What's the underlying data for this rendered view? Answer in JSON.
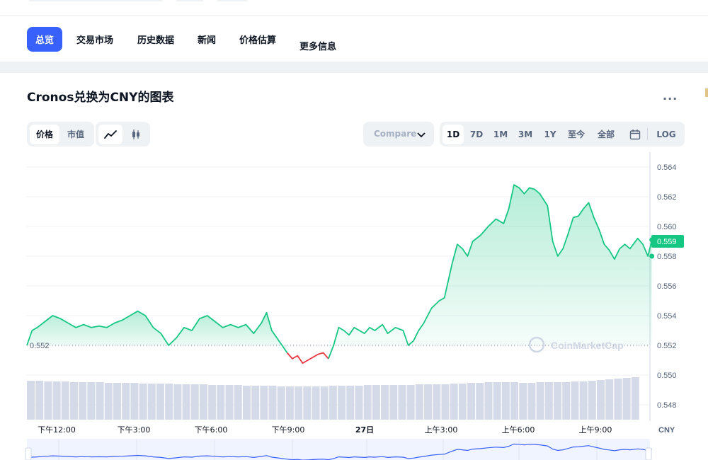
{
  "nav": {
    "tabs": [
      {
        "label": "总览",
        "active": true
      },
      {
        "label": "交易市场"
      },
      {
        "label": "历史数据"
      },
      {
        "label": "新闻"
      },
      {
        "label": "价格估算"
      },
      {
        "label": "更多信息"
      }
    ]
  },
  "chart_header": {
    "title": "Cronos兑换为CNY的图表",
    "more_label": "..."
  },
  "controls": {
    "metric_tabs": [
      "价格",
      "市值"
    ],
    "active_metric": "价格",
    "chart_types": [
      "line-chart-icon",
      "candlestick-icon"
    ],
    "compare_label": "Compare",
    "ranges": [
      "1D",
      "7D",
      "1M",
      "3M",
      "1Y",
      "至今",
      "全部"
    ],
    "active_range": "1D",
    "calendar_icon": "calendar-icon",
    "log_label": "LOG"
  },
  "colors": {
    "accent": "#3861fb",
    "up": "#16c784",
    "down": "#ea3943",
    "grid": "#eff2f5",
    "text_muted": "#58667e"
  },
  "chart_data": {
    "type": "line",
    "currency": "CNY",
    "ylim": [
      0.547,
      0.565
    ],
    "y_ticks": [
      "0.564",
      "0.562",
      "0.560",
      "0.558",
      "0.556",
      "0.554",
      "0.552",
      "0.550",
      "0.548"
    ],
    "x_tick_labels": [
      "下午12:00",
      "下午3:00",
      "下午6:00",
      "下午9:00",
      "27日",
      "上午3:00",
      "上午6:00",
      "上午9:00"
    ],
    "x_axis_unit_label": "CNY",
    "x_range_hours": [
      11.6,
      34.8
    ],
    "open_price": 0.552,
    "open_price_label": "0.552",
    "current_price": 0.559,
    "current_price_label": "0.559",
    "watermark": "CoinMarketCap",
    "series": [
      {
        "points": [
          [
            11.6,
            0.552
          ],
          [
            11.8,
            0.553
          ],
          [
            12.0,
            0.5532
          ],
          [
            12.3,
            0.5536
          ],
          [
            12.6,
            0.554
          ],
          [
            12.9,
            0.5538
          ],
          [
            13.2,
            0.5535
          ],
          [
            13.5,
            0.5532
          ],
          [
            13.8,
            0.5534
          ],
          [
            14.1,
            0.5532
          ],
          [
            14.4,
            0.5533
          ],
          [
            14.7,
            0.5532
          ],
          [
            15.0,
            0.5535
          ],
          [
            15.3,
            0.5537
          ],
          [
            15.6,
            0.554
          ],
          [
            15.9,
            0.5543
          ],
          [
            16.2,
            0.554
          ],
          [
            16.5,
            0.5532
          ],
          [
            16.8,
            0.5528
          ],
          [
            17.1,
            0.552
          ],
          [
            17.4,
            0.5525
          ],
          [
            17.7,
            0.5532
          ],
          [
            18.0,
            0.553
          ],
          [
            18.3,
            0.5538
          ],
          [
            18.6,
            0.554
          ],
          [
            18.9,
            0.5536
          ],
          [
            19.2,
            0.5532
          ],
          [
            19.5,
            0.5534
          ],
          [
            19.8,
            0.5532
          ],
          [
            20.1,
            0.5534
          ],
          [
            20.4,
            0.5528
          ],
          [
            20.7,
            0.5535
          ],
          [
            20.9,
            0.5542
          ],
          [
            21.1,
            0.553
          ],
          [
            21.3,
            0.5525
          ],
          [
            21.5,
            0.552
          ],
          [
            21.7,
            0.5515
          ]
        ]
      },
      {
        "points": [
          [
            21.7,
            0.5515
          ],
          [
            21.9,
            0.5511
          ],
          [
            22.1,
            0.5513
          ],
          [
            22.3,
            0.5508
          ],
          [
            22.5,
            0.551
          ],
          [
            22.7,
            0.5512
          ],
          [
            22.9,
            0.5514
          ],
          [
            23.1,
            0.5515
          ],
          [
            23.3,
            0.5511
          ]
        ]
      },
      {
        "points": [
          [
            23.3,
            0.5511
          ],
          [
            23.5,
            0.552
          ],
          [
            23.7,
            0.5532
          ],
          [
            23.9,
            0.553
          ],
          [
            24.1,
            0.5527
          ],
          [
            24.3,
            0.5532
          ],
          [
            24.5,
            0.553
          ],
          [
            24.7,
            0.5528
          ],
          [
            24.9,
            0.5532
          ],
          [
            25.1,
            0.553
          ],
          [
            25.4,
            0.5534
          ],
          [
            25.6,
            0.5528
          ],
          [
            25.9,
            0.5532
          ],
          [
            26.2,
            0.553
          ],
          [
            26.4,
            0.552
          ],
          [
            26.6,
            0.5523
          ],
          [
            26.8,
            0.553
          ],
          [
            27.0,
            0.5535
          ],
          [
            27.3,
            0.5545
          ],
          [
            27.6,
            0.555
          ],
          [
            27.8,
            0.5552
          ],
          [
            28.1,
            0.5575
          ],
          [
            28.3,
            0.5588
          ],
          [
            28.5,
            0.5585
          ],
          [
            28.7,
            0.558
          ],
          [
            28.9,
            0.559
          ],
          [
            29.2,
            0.5594
          ],
          [
            29.5,
            0.56
          ],
          [
            29.8,
            0.5605
          ],
          [
            30.1,
            0.5602
          ],
          [
            30.3,
            0.5612
          ],
          [
            30.5,
            0.5628
          ],
          [
            30.7,
            0.5626
          ],
          [
            30.9,
            0.5622
          ],
          [
            31.1,
            0.5626
          ],
          [
            31.3,
            0.5625
          ],
          [
            31.5,
            0.5622
          ],
          [
            31.8,
            0.5614
          ],
          [
            32.0,
            0.559
          ],
          [
            32.2,
            0.558
          ],
          [
            32.4,
            0.5585
          ],
          [
            32.6,
            0.5595
          ],
          [
            32.8,
            0.5606
          ],
          [
            33.0,
            0.5607
          ],
          [
            33.2,
            0.5612
          ],
          [
            33.4,
            0.5616
          ],
          [
            33.6,
            0.5606
          ],
          [
            33.8,
            0.5598
          ],
          [
            34.0,
            0.5588
          ],
          [
            34.2,
            0.5584
          ],
          [
            34.4,
            0.5578
          ],
          [
            34.6,
            0.5585
          ],
          [
            34.8,
            0.5588
          ],
          [
            35.0,
            0.5585
          ],
          [
            35.3,
            0.5592
          ],
          [
            35.5,
            0.5588
          ],
          [
            35.7,
            0.558
          ],
          [
            35.85,
            0.5591
          ]
        ]
      }
    ],
    "volume": [
      0.55,
      0.55,
      0.54,
      0.54,
      0.54,
      0.53,
      0.53,
      0.53,
      0.53,
      0.52,
      0.52,
      0.52,
      0.52,
      0.51,
      0.51,
      0.51,
      0.51,
      0.5,
      0.5,
      0.5,
      0.5,
      0.49,
      0.49,
      0.49,
      0.49,
      0.48,
      0.48,
      0.48,
      0.48,
      0.47,
      0.47,
      0.47,
      0.47,
      0.47,
      0.47,
      0.48,
      0.48,
      0.48,
      0.48,
      0.49,
      0.49,
      0.49,
      0.49,
      0.49,
      0.49,
      0.5,
      0.5,
      0.5,
      0.5,
      0.51,
      0.51,
      0.52,
      0.52,
      0.53,
      0.53,
      0.53,
      0.53,
      0.52,
      0.52,
      0.53,
      0.53,
      0.53,
      0.53,
      0.54,
      0.54,
      0.55,
      0.56,
      0.57,
      0.58,
      0.59,
      0.6
    ]
  }
}
